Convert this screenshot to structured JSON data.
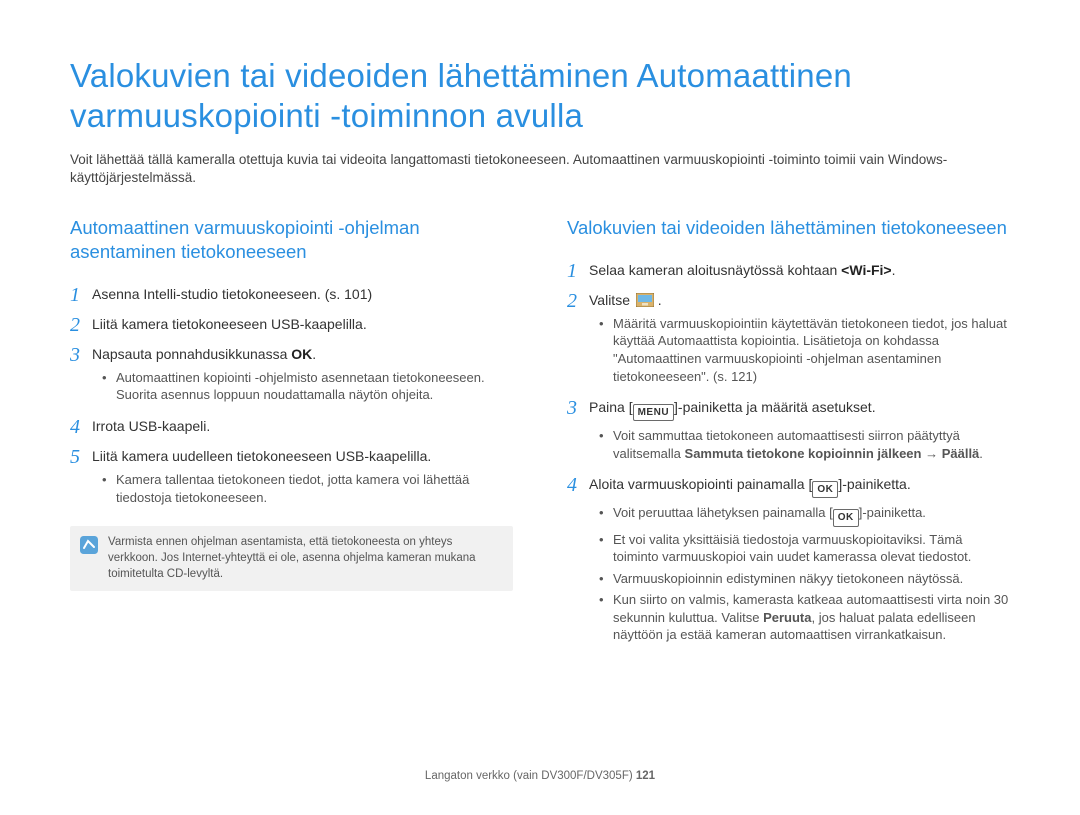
{
  "title": "Valokuvien tai videoiden lähettäminen Automaattinen varmuuskopiointi -toiminnon avulla",
  "intro": "Voit lähettää tällä kameralla otettuja kuvia tai videoita langattomasti tietokoneeseen. Automaattinen varmuuskopiointi -toiminto toimii vain Windows-käyttöjärjestelmässä.",
  "left": {
    "heading": "Automaattinen varmuuskopiointi -ohjelman asentaminen tietokoneeseen",
    "s1n": "1",
    "s1": "Asenna Intelli-studio tietokoneeseen. (s. 101)",
    "s2n": "2",
    "s2": "Liitä kamera tietokoneeseen USB-kaapelilla.",
    "s3n": "3",
    "s3a": "Napsauta ponnahdusikkunassa ",
    "s3b": "OK",
    "s3c": ".",
    "s3sub": "Automaattinen kopiointi -ohjelmisto asennetaan tietokoneeseen. Suorita asennus loppuun noudattamalla näytön ohjeita.",
    "s4n": "4",
    "s4": "Irrota USB-kaapeli.",
    "s5n": "5",
    "s5": "Liitä kamera uudelleen tietokoneeseen USB-kaapelilla.",
    "s5sub": "Kamera tallentaa tietokoneen tiedot, jotta kamera voi lähettää tiedostoja tietokoneeseen.",
    "note": "Varmista ennen ohjelman asentamista, että tietokoneesta on yhteys verkkoon. Jos Internet-yhteyttä ei ole, asenna ohjelma kameran mukana toimitetulta CD-levyltä."
  },
  "right": {
    "heading": "Valokuvien tai videoiden lähettäminen tietokoneeseen",
    "s1n": "1",
    "s1a": "Selaa kameran aloitusnäytössä kohtaan ",
    "s1b": "<Wi-Fi>",
    "s1c": ".",
    "s2n": "2",
    "s2": "Valitse ",
    "s2sub": "Määritä varmuuskopiointiin käytettävän tietokoneen tiedot, jos haluat käyttää Automaattista kopiointia. Lisätietoja on kohdassa \"Automaattinen varmuuskopiointi -ohjelman asentaminen tietokoneeseen\". (s. 121)",
    "s3n": "3",
    "s3a": "Paina [",
    "s3menu": "MENU",
    "s3b": "]-painiketta ja määritä asetukset.",
    "s3sub_a": "Voit sammuttaa tietokoneen automaattisesti siirron päätyttyä valitsemalla ",
    "s3sub_b": "Sammuta tietokone kopioinnin jälkeen",
    "s3sub_arrow": " → ",
    "s3sub_c": "Päällä",
    "s3sub_d": ".",
    "s4n": "4",
    "s4a": "Aloita varmuuskopiointi painamalla [",
    "s4ok": "OK",
    "s4b": "]-painiketta.",
    "s4sub1a": "Voit peruuttaa lähetyksen painamalla [",
    "s4sub1ok": "OK",
    "s4sub1b": "]-painiketta.",
    "s4sub2": "Et voi valita yksittäisiä tiedostoja varmuuskopioitaviksi. Tämä toiminto varmuuskopioi vain uudet kamerassa olevat tiedostot.",
    "s4sub3": "Varmuuskopioinnin edistyminen näkyy tietokoneen näytössä.",
    "s4sub4a": "Kun siirto on valmis, kamerasta katkeaa automaattisesti virta noin 30 sekunnin kuluttua. Valitse ",
    "s4sub4b": "Peruuta",
    "s4sub4c": ", jos haluat palata edelliseen näyttöön ja estää kameran automaattisen virrankatkaisun."
  },
  "footer_a": "Langaton verkko (vain DV300F/DV305F)  ",
  "footer_b": "121"
}
